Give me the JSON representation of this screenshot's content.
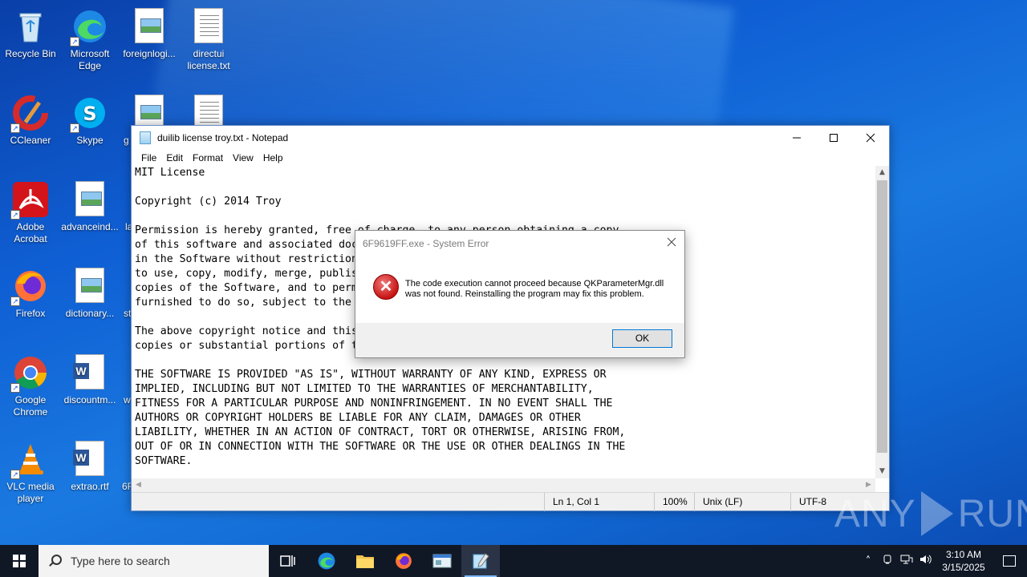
{
  "desktop": {
    "icons": [
      {
        "label": "Recycle Bin",
        "icon": "recycle-bin-icon"
      },
      {
        "label": "Microsoft Edge",
        "icon": "edge-icon"
      },
      {
        "label": "foreignlogi...",
        "icon": "image-file-icon"
      },
      {
        "label": "directui license.txt",
        "icon": "text-file-icon"
      },
      {
        "label": "CCleaner",
        "icon": "ccleaner-icon"
      },
      {
        "label": "Skype",
        "icon": "skype-icon"
      },
      {
        "label": "g",
        "icon": "image-file-icon"
      },
      {
        "label": "",
        "icon": "text-file-icon"
      },
      {
        "label": "Adobe Acrobat",
        "icon": "acrobat-icon"
      },
      {
        "label": "advanceind...",
        "icon": "image-file-icon"
      },
      {
        "label": "la",
        "icon": "file-icon"
      },
      {
        "label": "Firefox",
        "icon": "firefox-icon"
      },
      {
        "label": "dictionary...",
        "icon": "image-file-icon"
      },
      {
        "label": "st",
        "icon": "file-icon"
      },
      {
        "label": "Google Chrome",
        "icon": "chrome-icon"
      },
      {
        "label": "discountm...",
        "icon": "word-file-icon"
      },
      {
        "label": "w",
        "icon": "file-icon"
      },
      {
        "label": "VLC media player",
        "icon": "vlc-icon"
      },
      {
        "label": "extrao.rtf",
        "icon": "word-file-icon"
      },
      {
        "label": "6F",
        "icon": "file-icon"
      }
    ]
  },
  "notepad": {
    "title": "duilib license troy.txt - Notepad",
    "menu": [
      "File",
      "Edit",
      "Format",
      "View",
      "Help"
    ],
    "lines": [
      "MIT License",
      "",
      "Copyright (c) 2014 Troy",
      "",
      "Permission is hereby granted, free of charge, to any person obtaining a copy",
      "of this software and associated documentation files (the \"Software\"), to deal",
      "in the Software without restriction, including without limitation the rights",
      "to use, copy, modify, merge, publish, distribute, sublicense, and/or sell",
      "copies of the Software, and to permit persons to whom the Software is",
      "furnished to do so, subject to the following conditions:",
      "",
      "The above copyright notice and this permission notice shall be included in all",
      "copies or substantial portions of the Software.",
      "",
      "THE SOFTWARE IS PROVIDED \"AS IS\", WITHOUT WARRANTY OF ANY KIND, EXPRESS OR",
      "IMPLIED, INCLUDING BUT NOT LIMITED TO THE WARRANTIES OF MERCHANTABILITY,",
      "FITNESS FOR A PARTICULAR PURPOSE AND NONINFRINGEMENT. IN NO EVENT SHALL THE",
      "AUTHORS OR COPYRIGHT HOLDERS BE LIABLE FOR ANY CLAIM, DAMAGES OR OTHER",
      "LIABILITY, WHETHER IN AN ACTION OF CONTRACT, TORT OR OTHERWISE, ARISING FROM,",
      "OUT OF OR IN CONNECTION WITH THE SOFTWARE OR THE USE OR OTHER DEALINGS IN THE",
      "SOFTWARE."
    ],
    "status": {
      "position": "Ln 1, Col 1",
      "zoom": "100%",
      "line_ending": "Unix (LF)",
      "encoding": "UTF-8"
    }
  },
  "dialog": {
    "title": "6F9619FF.exe - System Error",
    "message": "The code execution cannot proceed because QKParameterMgr.dll was not found. Reinstalling the program may fix this problem.",
    "ok_label": "OK"
  },
  "taskbar": {
    "search_placeholder": "Type here to search",
    "clock_time": "3:10 AM",
    "clock_date": "3/15/2025"
  },
  "watermark": {
    "left": "ANY",
    "right": "RUN"
  }
}
